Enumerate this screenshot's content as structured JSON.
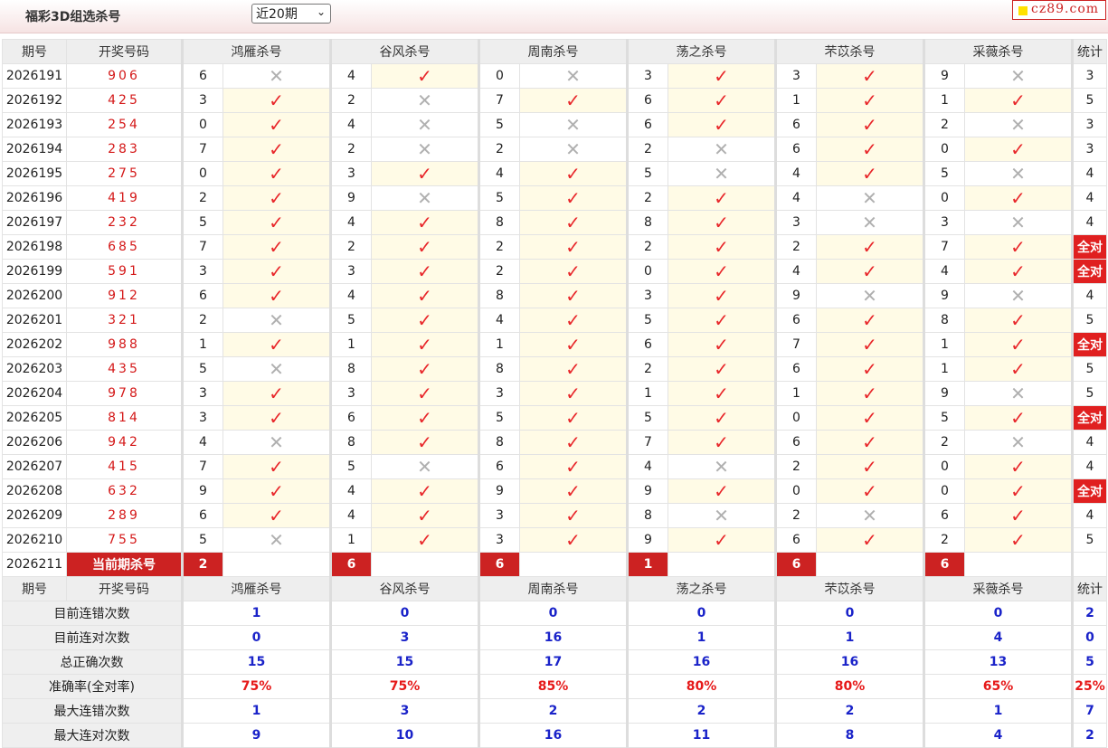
{
  "header": {
    "title": "福彩3D组选杀号",
    "period_select": "近20期",
    "logo": "cz89.com"
  },
  "columns": {
    "issue": "期号",
    "draw": "开奖号码",
    "experts": [
      "鸿雁杀号",
      "谷风杀号",
      "周南杀号",
      "荡之杀号",
      "芣苡杀号",
      "采薇杀号"
    ],
    "stats": "统计"
  },
  "rows": [
    {
      "issue": "2026191",
      "draw": "906",
      "picks": [
        "6",
        "4",
        "0",
        "3",
        "3",
        "9"
      ],
      "results": [
        0,
        1,
        0,
        1,
        1,
        0
      ],
      "stat": "3"
    },
    {
      "issue": "2026192",
      "draw": "425",
      "picks": [
        "3",
        "2",
        "7",
        "6",
        "1",
        "1"
      ],
      "results": [
        1,
        0,
        1,
        1,
        1,
        1
      ],
      "stat": "5"
    },
    {
      "issue": "2026193",
      "draw": "254",
      "picks": [
        "0",
        "4",
        "5",
        "6",
        "6",
        "2"
      ],
      "results": [
        1,
        0,
        0,
        1,
        1,
        0
      ],
      "stat": "3"
    },
    {
      "issue": "2026194",
      "draw": "283",
      "picks": [
        "7",
        "2",
        "2",
        "2",
        "6",
        "0"
      ],
      "results": [
        1,
        0,
        0,
        0,
        1,
        1
      ],
      "stat": "3"
    },
    {
      "issue": "2026195",
      "draw": "275",
      "picks": [
        "0",
        "3",
        "4",
        "5",
        "4",
        "5"
      ],
      "results": [
        1,
        1,
        1,
        0,
        1,
        0
      ],
      "stat": "4"
    },
    {
      "issue": "2026196",
      "draw": "419",
      "picks": [
        "2",
        "9",
        "5",
        "2",
        "4",
        "0"
      ],
      "results": [
        1,
        0,
        1,
        1,
        0,
        1
      ],
      "stat": "4"
    },
    {
      "issue": "2026197",
      "draw": "232",
      "picks": [
        "5",
        "4",
        "8",
        "8",
        "3",
        "3"
      ],
      "results": [
        1,
        1,
        1,
        1,
        0,
        0
      ],
      "stat": "4"
    },
    {
      "issue": "2026198",
      "draw": "685",
      "picks": [
        "7",
        "2",
        "2",
        "2",
        "2",
        "7"
      ],
      "results": [
        1,
        1,
        1,
        1,
        1,
        1
      ],
      "stat": "全对"
    },
    {
      "issue": "2026199",
      "draw": "591",
      "picks": [
        "3",
        "3",
        "2",
        "0",
        "4",
        "4"
      ],
      "results": [
        1,
        1,
        1,
        1,
        1,
        1
      ],
      "stat": "全对"
    },
    {
      "issue": "2026200",
      "draw": "912",
      "picks": [
        "6",
        "4",
        "8",
        "3",
        "9",
        "9"
      ],
      "results": [
        1,
        1,
        1,
        1,
        0,
        0
      ],
      "stat": "4"
    },
    {
      "issue": "2026201",
      "draw": "321",
      "picks": [
        "2",
        "5",
        "4",
        "5",
        "6",
        "8"
      ],
      "results": [
        0,
        1,
        1,
        1,
        1,
        1
      ],
      "stat": "5"
    },
    {
      "issue": "2026202",
      "draw": "988",
      "picks": [
        "1",
        "1",
        "1",
        "6",
        "7",
        "1"
      ],
      "results": [
        1,
        1,
        1,
        1,
        1,
        1
      ],
      "stat": "全对"
    },
    {
      "issue": "2026203",
      "draw": "435",
      "picks": [
        "5",
        "8",
        "8",
        "2",
        "6",
        "1"
      ],
      "results": [
        0,
        1,
        1,
        1,
        1,
        1
      ],
      "stat": "5"
    },
    {
      "issue": "2026204",
      "draw": "978",
      "picks": [
        "3",
        "3",
        "3",
        "1",
        "1",
        "9"
      ],
      "results": [
        1,
        1,
        1,
        1,
        1,
        0
      ],
      "stat": "5"
    },
    {
      "issue": "2026205",
      "draw": "814",
      "picks": [
        "3",
        "6",
        "5",
        "5",
        "0",
        "5"
      ],
      "results": [
        1,
        1,
        1,
        1,
        1,
        1
      ],
      "stat": "全对"
    },
    {
      "issue": "2026206",
      "draw": "942",
      "picks": [
        "4",
        "8",
        "8",
        "7",
        "6",
        "2"
      ],
      "results": [
        0,
        1,
        1,
        1,
        1,
        0
      ],
      "stat": "4"
    },
    {
      "issue": "2026207",
      "draw": "415",
      "picks": [
        "7",
        "5",
        "6",
        "4",
        "2",
        "0"
      ],
      "results": [
        1,
        0,
        1,
        0,
        1,
        1
      ],
      "stat": "4"
    },
    {
      "issue": "2026208",
      "draw": "632",
      "picks": [
        "9",
        "4",
        "9",
        "9",
        "0",
        "0"
      ],
      "results": [
        1,
        1,
        1,
        1,
        1,
        1
      ],
      "stat": "全对"
    },
    {
      "issue": "2026209",
      "draw": "289",
      "picks": [
        "6",
        "4",
        "3",
        "8",
        "2",
        "6"
      ],
      "results": [
        1,
        1,
        1,
        0,
        0,
        1
      ],
      "stat": "4"
    },
    {
      "issue": "2026210",
      "draw": "755",
      "picks": [
        "5",
        "1",
        "3",
        "9",
        "6",
        "2"
      ],
      "results": [
        0,
        1,
        1,
        1,
        1,
        1
      ],
      "stat": "5"
    }
  ],
  "current": {
    "issue": "2026211",
    "label": "当前期杀号",
    "picks": [
      "2",
      "6",
      "6",
      "1",
      "6",
      "6"
    ]
  },
  "summary": [
    {
      "label": "目前连错次数",
      "values": [
        "1",
        "0",
        "0",
        "0",
        "0",
        "0"
      ],
      "stat": "2",
      "style": "blue"
    },
    {
      "label": "目前连对次数",
      "values": [
        "0",
        "3",
        "16",
        "1",
        "1",
        "4"
      ],
      "stat": "0",
      "style": "blue"
    },
    {
      "label": "总正确次数",
      "values": [
        "15",
        "15",
        "17",
        "16",
        "16",
        "13"
      ],
      "stat": "5",
      "style": "blue"
    },
    {
      "label": "准确率(全对率)",
      "values": [
        "75%",
        "75%",
        "85%",
        "80%",
        "80%",
        "65%"
      ],
      "stat": "25%",
      "style": "red"
    },
    {
      "label": "最大连错次数",
      "values": [
        "1",
        "3",
        "2",
        "2",
        "2",
        "1"
      ],
      "stat": "7",
      "style": "blue"
    },
    {
      "label": "最大连对次数",
      "values": [
        "9",
        "10",
        "16",
        "11",
        "8",
        "4"
      ],
      "stat": "2",
      "style": "blue"
    }
  ],
  "marks": {
    "ok": "✓",
    "no": "✕"
  },
  "colors": {
    "accent_red": "#e02020",
    "blue": "#1a23c9",
    "hit_bg": "#fffbe6"
  }
}
